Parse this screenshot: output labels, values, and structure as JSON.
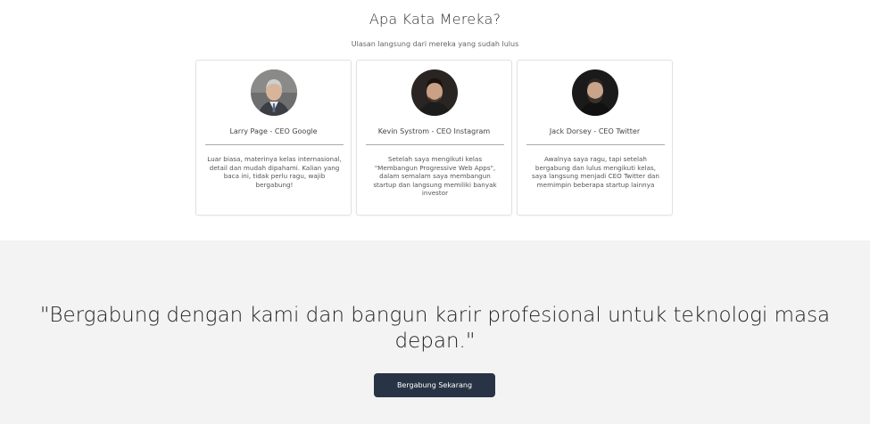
{
  "testimonials": {
    "title": "Apa Kata Mereka?",
    "subtitle": "Ulasan langsung dari mereka yang sudah lulus",
    "cards": [
      {
        "name": "Larry Page - CEO Google",
        "quote": "Luar biasa, materinya kelas internasional, detail dan mudah dipahami. Kalian yang baca ini, tidak perlu ragu, wajib bergabung!"
      },
      {
        "name": "Kevin Systrom - CEO Instagram",
        "quote": "Setelah saya mengikuti kelas \"Membangun Progressive Web Apps\", dalam semalam saya membangun startup dan langsung memiliki banyak investor"
      },
      {
        "name": "Jack Dorsey - CEO Twitter",
        "quote": "Awalnya saya ragu, tapi setelah bergabung dan lulus mengikuti kelas, saya langsung menjadi CEO Twitter dan memimpin beberapa startup lainnya"
      }
    ]
  },
  "cta": {
    "quote": "\"Bergabung dengan kami dan bangun karir profesional untuk teknologi masa depan.\"",
    "button_label": "Bergabung Sekarang",
    "button_color": "#283445"
  }
}
